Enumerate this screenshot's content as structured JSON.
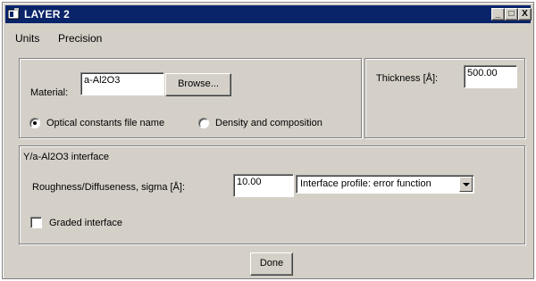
{
  "window": {
    "title": "LAYER 2",
    "minimize_glyph": "_",
    "maximize_glyph": "□",
    "close_glyph": "X"
  },
  "menu": [
    "Units",
    "Precision"
  ],
  "material": {
    "label": "Material:",
    "value": "a-Al2O3",
    "browse_label": "Browse...",
    "option_optical": "Optical constants file name",
    "option_density": "Density and composition",
    "selected_option": "Optical constants file name"
  },
  "thickness": {
    "label": "Thickness [Å]:",
    "value": "500.00"
  },
  "interface": {
    "title": "Y/a-Al2O3 interface",
    "roughness_label": "Roughness/Diffuseness, sigma [Å]:",
    "roughness_value": "10.00",
    "profile_selected": "Interface profile: error function",
    "graded_label": "Graded interface",
    "graded_checked": false
  },
  "done_label": "Done",
  "colors": {
    "title_bar": "#0a246a",
    "face": "#d4d0c8"
  }
}
